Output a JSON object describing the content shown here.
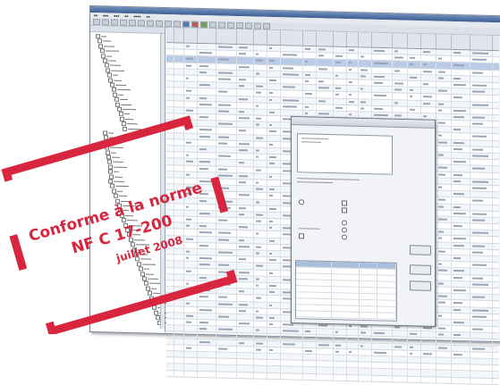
{
  "stamp": {
    "line1": "Conforme à la norme",
    "line2": "NF C 17-200",
    "line3": "juillet 2008",
    "color": "#d7263d"
  },
  "app": {
    "accent": "#4f78b8",
    "titlebar_color": "#3e5e93"
  },
  "icons": [
    "window-title-icon",
    "toolbar-icons"
  ]
}
